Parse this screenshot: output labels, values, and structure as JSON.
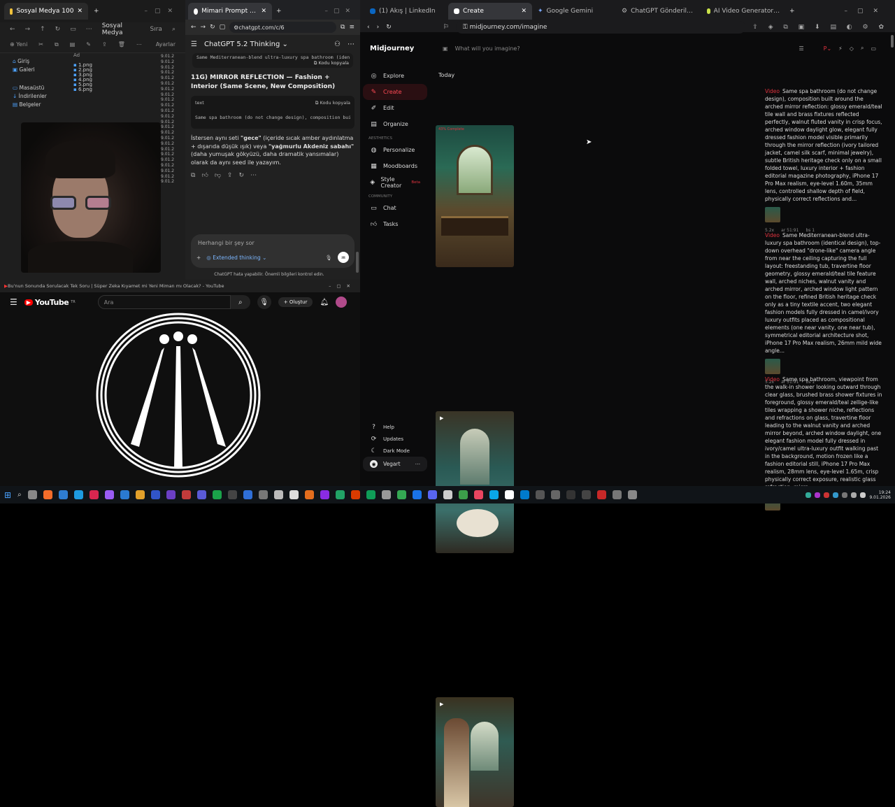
{
  "win1": {
    "tab_title": "Sosyal Medya 100",
    "toolbar": {
      "new": "Yeni",
      "folder": "Sosyal Medya",
      "sort": "Sıra",
      "settings": "Ayarlar"
    },
    "col_name": "Ad",
    "sidebar": [
      "Giriş",
      "Galeri",
      "Masaüstü",
      "İndirilenler",
      "Belgeler"
    ],
    "files": [
      "1.png",
      "2.png",
      "3.png",
      "4.png",
      "5.png",
      "6.png"
    ],
    "dates": [
      "9.01.2",
      "9.01.2",
      "9.01.2",
      "9.01.2",
      "9.01.2",
      "9.01.2",
      "9.01.2",
      "9.01.2",
      "9.01.2",
      "9.01.2",
      "9.01.2",
      "9.01.2",
      "9.01.2",
      "9.01.2",
      "9.01.2",
      "9.01.2",
      "9.01.2",
      "9.01.2",
      "9.01.2",
      "9.01.2",
      "9.01.2",
      "9.01.2",
      "9.01.2",
      "9.01.2"
    ]
  },
  "win2": {
    "tab_title": "Mimari Prompt Oluşturma",
    "url": "chatgpt.com/c/6",
    "model": "ChatGPT 5.2 Thinking",
    "copy_label": "Kodu kopyala",
    "top_code": "Same Mediterranean-blend ultra-luxury spa bathroom (iden",
    "heading": "11G) MIRROR REFLECTION — Fashion + Interior (Same Scene, New Composition)",
    "code_lang": "text",
    "code": "Same spa bathroom (do not change design), composition bui",
    "para1": "İstersen aynı seti ",
    "para_q1": "\"gece\"",
    "para2": " (içeride sıcak amber aydınlatma + dışarıda düşük ışık) veya ",
    "para_q2": "\"yağmurlu Akdeniz sabahı\"",
    "para3": " (daha yumuşak gökyüzü, daha dramatik yansımalar) olarak da aynı seed ile yazayım.",
    "input_placeholder": "Herhangi bir şey sor",
    "ext_thinking": "Extended thinking",
    "disclaimer": "ChatGPT hata yapabilir. Önemli bilgileri kontrol edin."
  },
  "win3": {
    "title": "Bu'nun Sonunda Sorulacak Tek Soru | Süper Zeka Kıyamet mi Yeni Miman mı Olacak? - YouTube",
    "search_placeholder": "Ara",
    "create_label": "Oluştur",
    "logo_text": "YouTube",
    "country": "TR"
  },
  "win4": {
    "tabs": [
      "(1) Akış | LinkedIn",
      "Create",
      "Google Gemini",
      "ChatGPT Gönderiler | Yapay Zeka'lı Gö",
      "AI Video Generator & Image Generat"
    ],
    "url": "midjourney.com/imagine",
    "brand": "Midjourney",
    "prompt_placeholder": "What will you imagine?",
    "today": "Today",
    "nav": [
      {
        "label": "Explore",
        "icon": "compass-icon"
      },
      {
        "label": "Create",
        "icon": "brush-icon"
      },
      {
        "label": "Edit",
        "icon": "pencil-icon"
      },
      {
        "label": "Organize",
        "icon": "folder-icon"
      }
    ],
    "aesthetics_label": "AESTHETICS",
    "aesthetics": [
      "Personalize",
      "Moodboards",
      "Style Creator"
    ],
    "beta": "Beta",
    "community_label": "COMMUNITY",
    "community": [
      "Chat",
      "Tasks"
    ],
    "bottom": [
      "Help",
      "Updates",
      "Dark Mode"
    ],
    "user": "Vegart",
    "progress_label": "43% Complete",
    "prompts": [
      {
        "badge": "Video",
        "text": "Same spa bathroom (do not change design), composition built around the arched mirror reflection: glossy emerald/teal tile wall and brass fixtures reflected perfectly, walnut fluted vanity in crisp focus, arched window daylight glow, elegant fully dressed fashion model visible primarily through the mirror reflection (ivory tailored jacket, camel silk scarf, minimal jewelry), subtle British heritage check only on a small folded towel, luxury interior + fashion editorial magazine photography, iPhone 17 Pro Max realism, eye-level 1.60m, 35mm lens, controlled shallow depth of field, physically correct reflections and...",
        "meta": [
          "5.2x",
          "ar 51:91",
          "bs 1"
        ]
      },
      {
        "badge": "Video",
        "text": "Same Mediterranean-blend ultra-luxury spa bathroom (identical design), top-down overhead \"drone-like\" camera angle from near the ceiling capturing the full layout: freestanding tub, travertine floor geometry, glossy emerald/teal tile feature wall, arched niches, walnut vanity and arched mirror, arched window light pattern on the floor, refined British heritage check only as a tiny textile accent, two elegant fashion models fully dressed in camel/ivory luxury outfits placed as compositional elements (one near vanity, one near tub), symmetrical editorial architecture shot, iPhone 17 Pro Max realism, 26mm mild wide angle...",
        "meta": [
          "5.2x",
          "ar 51:91",
          "bs 1"
        ]
      },
      {
        "badge": "Video",
        "text": "Same spa bathroom, viewpoint from the walk-in shower looking outward through clear glass, brushed brass shower fixtures in foreground, glossy emerald/teal zellige-like tiles wrapping a shower niche, reflections and refractions on glass, travertine floor leading to the walnut vanity and arched mirror beyond, arched window daylight, one elegant fashion model fully dressed in ivory/camel ultra-luxury outfit walking past in the background, motion frozen like a fashion editorial still, iPhone 17 Pro Max realism, 28mm lens, eye-level 1.65m, crisp physically correct exposure, realistic glass refraction, micro...",
        "meta": []
      }
    ]
  },
  "taskbar": {
    "time": "19:24",
    "date": "9.01.2026"
  }
}
